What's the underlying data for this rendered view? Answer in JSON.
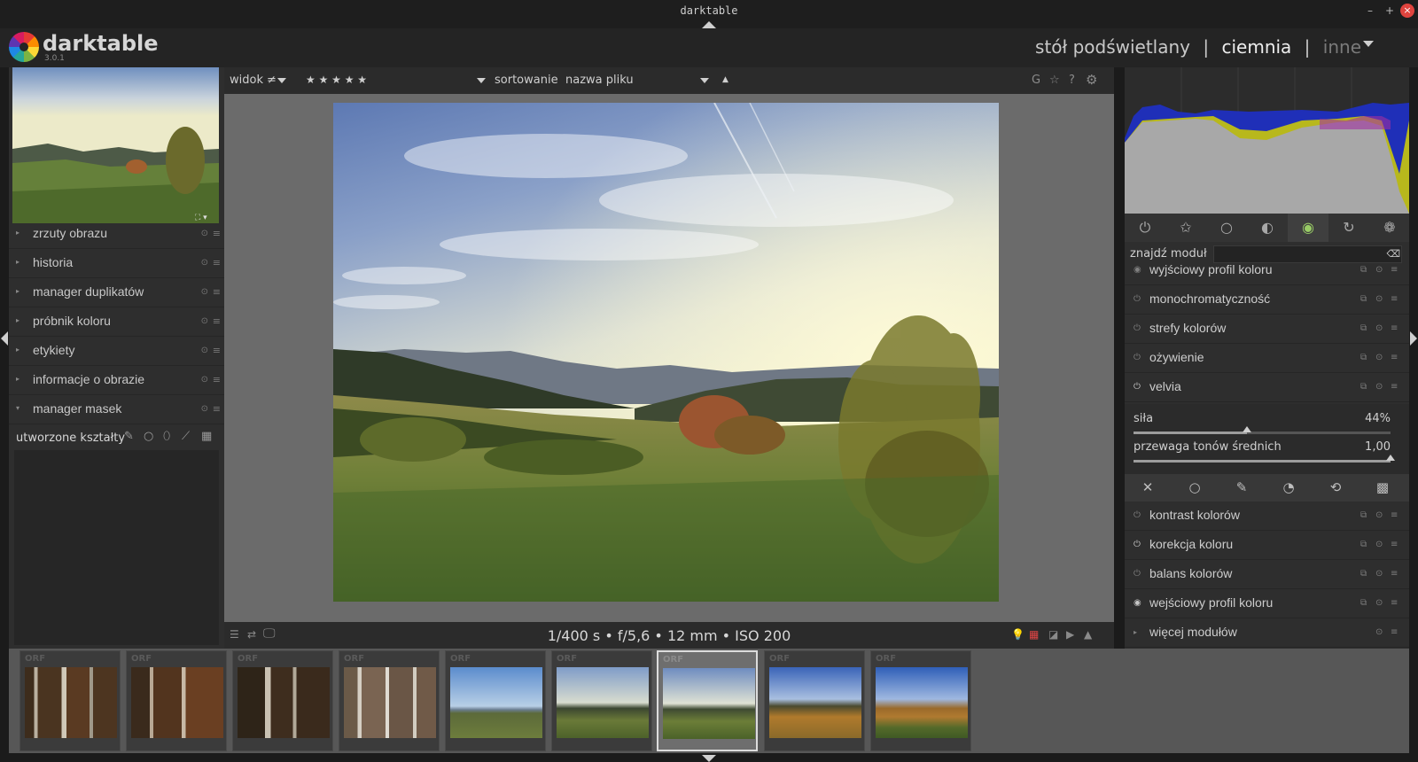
{
  "window": {
    "title": "darktable",
    "minimize": "–",
    "maximize": "+",
    "close": "×"
  },
  "header": {
    "app_name": "darktable",
    "version": "3.0.1",
    "views": {
      "lighttable": "stół podświetlany",
      "sep": "|",
      "darkroom": "ciemnia",
      "other": "inne"
    }
  },
  "left_panel": {
    "modules": [
      {
        "label": "zrzuty obrazu",
        "expanded": false
      },
      {
        "label": "historia",
        "expanded": false
      },
      {
        "label": "manager duplikatów",
        "expanded": false
      },
      {
        "label": "próbnik koloru",
        "expanded": false
      },
      {
        "label": "etykiety",
        "expanded": false
      },
      {
        "label": "informacje o obrazie",
        "expanded": false
      },
      {
        "label": "manager masek",
        "expanded": true
      }
    ],
    "shapes_label": "utworzone kształty"
  },
  "top_toolbar": {
    "view_label": "widok",
    "view_filter": "≠",
    "stars": "★ ★ ★ ★ ★",
    "sort_label": "sortowanie",
    "sort_value": "nazwa pliku",
    "sort_dir": "▲",
    "icon_g": "G",
    "icon_star": "☆",
    "icon_help": "?",
    "icon_gear": "⚙"
  },
  "image_info": {
    "exif": "1/400 s • f/5,6 • 12 mm • ISO 200"
  },
  "right_panel": {
    "find_module_label": "znajdź moduł",
    "find_module_value": "",
    "modules_top": [
      {
        "label": "wyjściowy profil koloru",
        "on": false
      },
      {
        "label": "monochromatyczność",
        "on": false
      },
      {
        "label": "strefy kolorów",
        "on": false
      },
      {
        "label": "ożywienie",
        "on": false
      },
      {
        "label": "velvia",
        "on": true
      }
    ],
    "velvia": {
      "sliders": [
        {
          "label": "siła",
          "value": "44%",
          "fraction": 0.44
        },
        {
          "label": "przewaga tonów średnich",
          "value": "1,00",
          "fraction": 1.0
        }
      ]
    },
    "modules_bottom": [
      {
        "label": "kontrast kolorów",
        "on": false
      },
      {
        "label": "korekcja koloru",
        "on": true
      },
      {
        "label": "balans kolorów",
        "on": false
      },
      {
        "label": "wejściowy profil koloru",
        "on": true
      },
      {
        "label": "więcej modułów",
        "on": false
      }
    ]
  },
  "filmstrip": {
    "badge": "ORF",
    "active_index": 6,
    "count": 9
  }
}
